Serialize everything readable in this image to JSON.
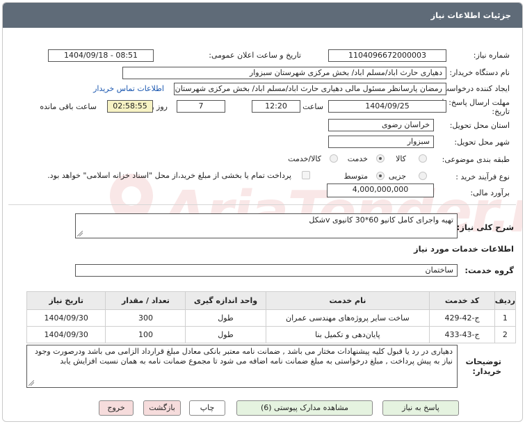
{
  "header": {
    "title": "جزئیات اطلاعات نیاز"
  },
  "fields": {
    "need_number_label": "شماره نیاز:",
    "need_number": "1104096672000003",
    "announce_label": "تاریخ و ساعت اعلان عمومی:",
    "announce_value": "1404/09/18 - 08:51",
    "buyer_org_label": "نام دستگاه خریدار:",
    "buyer_org": "دهیاری حارث اباد/مسلم اباد/ بخش مرکزی شهرستان سبزوار",
    "creator_label": "ایجاد کننده درخواست:",
    "creator": "رمضان پارسانظر مسئول مالی دهیاری حارث اباد/مسلم اباد/ بخش مرکزی شهرستان سبزوار",
    "contact_link": "اطلاعات تماس خریدار",
    "deadline_label_1": "مهلت ارسال پاسخ: تا",
    "deadline_label_2": "تاریخ:",
    "deadline_date": "1404/09/25",
    "time_label": "ساعت",
    "deadline_time": "12:20",
    "days": "7",
    "days_label": "روز و",
    "remaining_time": "02:58:55",
    "remaining_label": "ساعت باقی مانده",
    "province_label": "استان محل تحویل:",
    "province": "خراسان رضوی",
    "city_label": "شهر محل تحویل:",
    "city": "سبزوار",
    "category_label": "طبقه بندی موضوعی:",
    "category_options": [
      "کالا",
      "خدمت",
      "کالا/خدمت"
    ],
    "purchase_type_label": "نوع فرآیند خرید :",
    "purchase_options": [
      "جزیی",
      "متوسط"
    ],
    "payment_note": "پرداخت تمام یا بخشی از مبلغ خرید،از محل \"اسناد خزانه اسلامی\" خواهد بود.",
    "budget_label": "برآورد مالی:",
    "budget": "4,000,000,000"
  },
  "summary": {
    "label": "شرح کلی نیاز:",
    "value": "تهیه واجرای کامل کانیو 60*30 کانیوی vشکل"
  },
  "services": {
    "section_title": "اطلاعات خدمات مورد نیاز",
    "group_label": "گروه خدمت:",
    "group_value": "ساختمان",
    "columns": [
      "ردیف",
      "کد خدمت",
      "نام خدمت",
      "واحد اندازه گیری",
      "تعداد / مقدار",
      "تاریخ نیاز"
    ],
    "rows": [
      [
        "1",
        "ج-42-429",
        "ساخت سایر پروژه‌های مهندسی عمران",
        "طول",
        "300",
        "1404/09/30"
      ],
      [
        "2",
        "ج-43-433",
        "پایان‌دهی و تکمیل بنا",
        "طول",
        "100",
        "1404/09/30"
      ]
    ]
  },
  "buyer_notes": {
    "label_1": "توضیحات",
    "label_2": "خریدار:",
    "text": "دهیاری در رد یا قبول کلیه پیشنهادات مختار می باشد , ضمانت نامه معتبر بانکی معادل مبلغ قرارداد الزامی می باشد ودرصورت وجود نیاز به پیش پرداخت , مبلغ درخواستی به مبلغ ضمانت نامه اضافه می شود تا مجموع ضمانت نامه به همان نسبت افزایش یابد"
  },
  "buttons": {
    "respond": "پاسخ به نیاز",
    "attachments": "مشاهده مدارک پیوستی (6)",
    "print": "چاپ",
    "back": "بازگشت",
    "exit": "خروج"
  },
  "watermark": {
    "text": "AriaTender.neT"
  }
}
